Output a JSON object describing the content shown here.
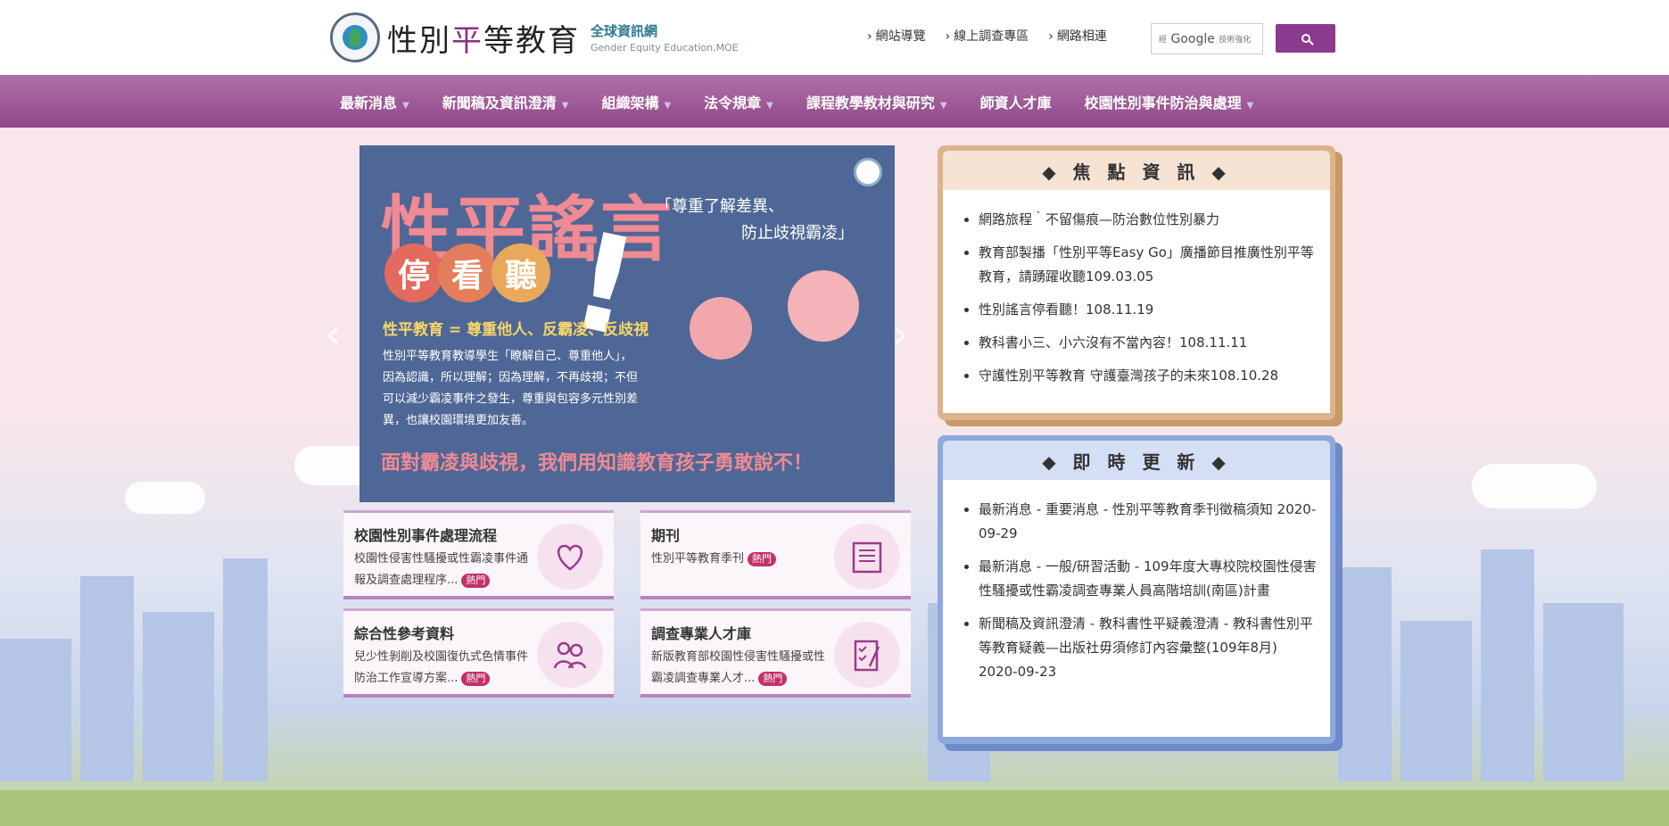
{
  "header": {
    "title_part1": "性別",
    "title_accent": "平",
    "title_part2": "等教育",
    "subtitle_cn": "全球資訊網",
    "subtitle_en": "Gender Equity Education,MOE",
    "seal_label": "MINISTRY OF EDUCATION",
    "top_links": [
      "網站導覽",
      "線上調查專區",
      "網路相連"
    ],
    "search_prefix": "經",
    "search_brand": "Google",
    "search_suffix": "技術強化",
    "search_icon": "search-icon"
  },
  "nav": {
    "items": [
      {
        "label": "最新消息",
        "dropdown": true
      },
      {
        "label": "新聞稿及資訊澄清",
        "dropdown": true
      },
      {
        "label": "組織架構",
        "dropdown": true
      },
      {
        "label": "法令規章",
        "dropdown": true
      },
      {
        "label": "課程教學教材與研究",
        "dropdown": true
      },
      {
        "label": "師資人才庫",
        "dropdown": false
      },
      {
        "label": "校園性別事件防治與處理",
        "dropdown": true
      }
    ]
  },
  "banner": {
    "title": "性平謠言",
    "circles": [
      "停",
      "看",
      "聽"
    ],
    "circle_colors": [
      "#e46a5d",
      "#e27e5a",
      "#e8a95c"
    ],
    "quote_line1": "「尊重了解差異、",
    "quote_line2": "防止歧視霸凌」",
    "yellow_line": "性平教育 = 尊重他人、反霸凌、反歧視",
    "body": "性別平等教育教導學生「瞭解自己、尊重他人」，因為認識，所以理解；因為理解，不再歧視；不但可以減少霸凌事件之發生，尊重與包容多元性別差異，也讓校園環境更加友善。",
    "bottom_line": "面對霸凌與歧視，我們用知識教育孩子勇敢說不！",
    "prev_icon": "chevron-left-icon",
    "next_icon": "chevron-right-icon"
  },
  "cards": [
    {
      "title": "校園性別事件處理流程",
      "desc": "校園性侵害性騷擾或性霸凌事件通報及調查處理程序...",
      "hot": "熱門",
      "icon": "heart-hands-icon"
    },
    {
      "title": "期刊",
      "desc": "性別平等教育季刊",
      "hot": "熱門",
      "icon": "book-icon"
    },
    {
      "title": "綜合性參考資料",
      "desc": "兒少性剝削及校園復仇式色情事件防治工作宣導方案...",
      "hot": "熱門",
      "icon": "people-icon"
    },
    {
      "title": "調查專業人才庫",
      "desc": "新版教育部校園性侵害性騷擾或性霸凌調查專業人才...",
      "hot": "熱門",
      "icon": "checklist-icon"
    }
  ],
  "focus": {
    "title": "◆ 焦 點 資 訊 ◆",
    "items": [
      "網路旅程｀不留傷痕—防治數位性別暴力",
      "教育部製播「性別平等Easy Go」廣播節目推廣性別平等教育，請踴躍收聽109.03.05",
      "性別謠言停看聽！108.11.19",
      "教科書小三、小六沒有不當內容！108.11.11",
      "守護性別平等教育 守護臺灣孩子的未來108.10.28"
    ]
  },
  "updates": {
    "title": "◆ 即 時 更 新 ◆",
    "items": [
      "最新消息 - 重要消息 - 性別平等教育季刊徵稿須知 2020-09-29",
      "最新消息 - 一般/研習活動 - 109年度大專校院校園性侵害性騷擾或性霸凌調查專業人員高階培訓(南區)計畫",
      "新聞稿及資訊澄清 - 教科書性平疑義澄清 - 教科書性別平等教育疑義—出版社毋須修訂內容彙整(109年8月) 2020-09-23"
    ]
  },
  "colors": {
    "nav_purple": "#9b5695",
    "focus_frame": "#d9a572",
    "updates_frame": "#7f9bd6",
    "hot_badge": "#c2316a",
    "page_bg": "#f8e6ea"
  }
}
